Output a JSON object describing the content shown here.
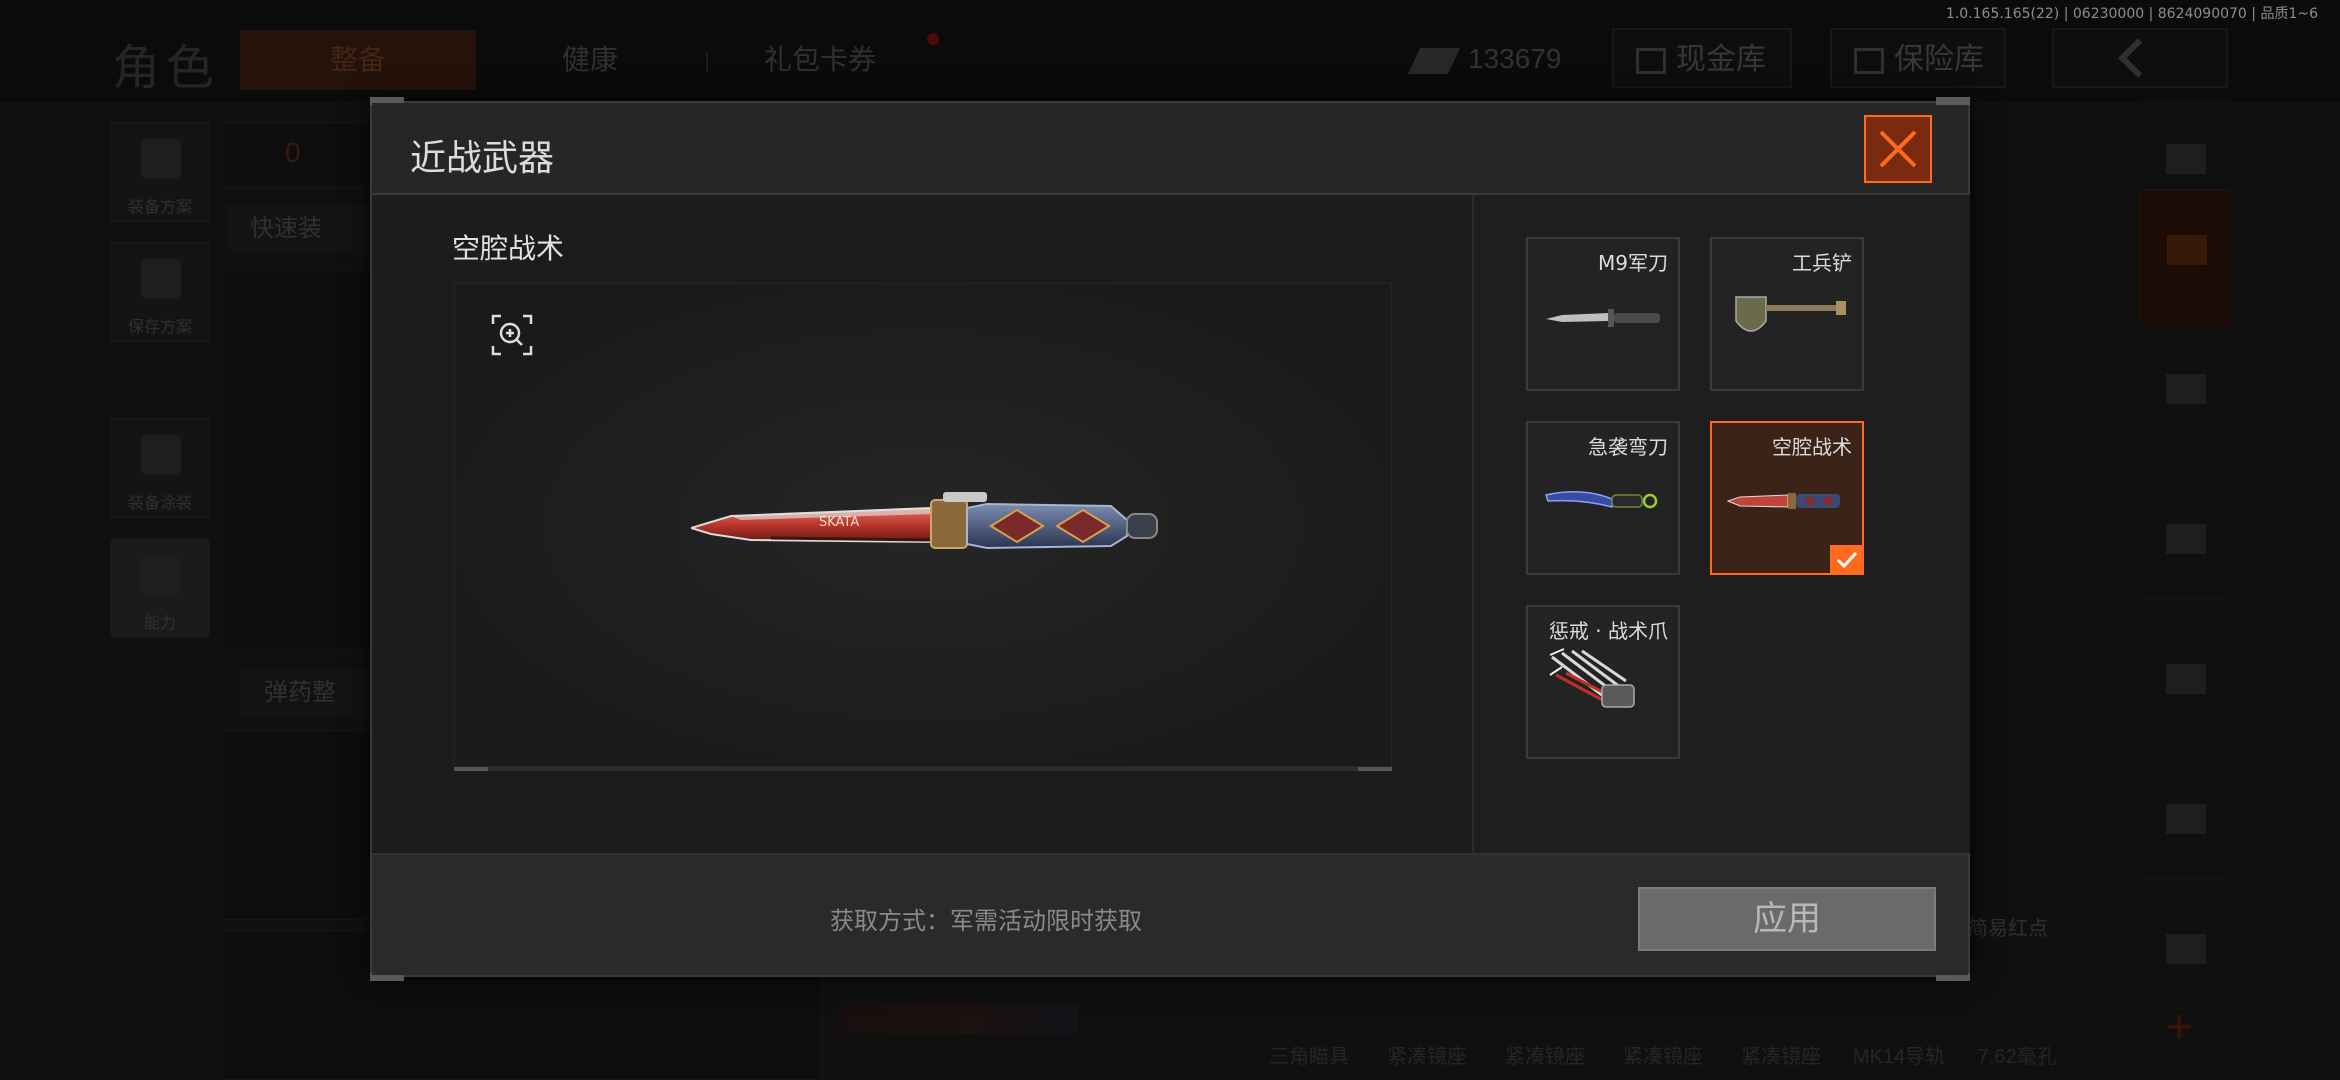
{
  "build_info": "1.0.165.165(22) | 06230000 | 8624090070 | 品质1~6",
  "background": {
    "title": "角色",
    "tabs": [
      "整备",
      "健康",
      "礼包卡券"
    ],
    "currency_value": "133679",
    "cash_vault_label": "现金库 0",
    "insurance_label": "保险库",
    "left_menu": [
      "装备方案",
      "保存方案",
      "装备涂装",
      "能力"
    ],
    "armor_count": "0",
    "quick_equip_label": "快速装",
    "ammo_label": "弹药整",
    "corner_label": "简易红点",
    "bottom_items": [
      "三角瞄具",
      "紧凑镜座",
      "紧凑镜座",
      "紧凑镜座",
      "紧凑镜座",
      "MK14导轨",
      "7.62毫孔"
    ]
  },
  "modal": {
    "title": "近战武器",
    "selected_name": "空腔战术",
    "acquire_text": "获取方式：军需活动限时获取",
    "apply_label": "应用",
    "items": [
      {
        "label": "M9军刀",
        "selected": false
      },
      {
        "label": "工兵铲",
        "selected": false
      },
      {
        "label": "急袭弯刀",
        "selected": false
      },
      {
        "label": "空腔战术",
        "selected": true
      },
      {
        "label": "惩戒 · 战术爪",
        "selected": false
      }
    ]
  },
  "colors": {
    "accent": "#ff6a1e",
    "close_bg": "#7a2a0e",
    "selected_bg": "#3b2317"
  }
}
